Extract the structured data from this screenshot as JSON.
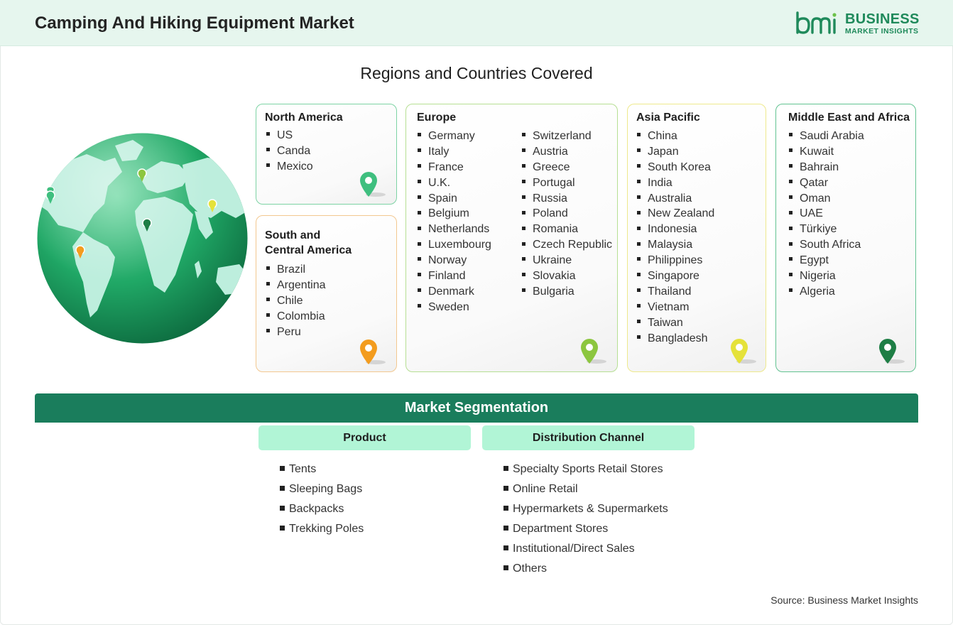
{
  "header": {
    "title": "Camping And Hiking Equipment Market",
    "logo": {
      "word1": "BUSINESS",
      "word2": "MARKET INSIGHTS",
      "mark": "bmi"
    }
  },
  "regions_section": {
    "title": "Regions and Countries Covered",
    "regions": {
      "north_america": {
        "title": "North America",
        "pin_color": "#3fbf7f",
        "items": [
          "US",
          "Canda",
          "Mexico"
        ]
      },
      "south_central_america": {
        "title_line1": "South and",
        "title_line2": "Central America",
        "pin_color": "#f39c1e",
        "items": [
          "Brazil",
          "Argentina",
          "Chile",
          "Colombia",
          "Peru"
        ]
      },
      "europe": {
        "title": "Europe",
        "pin_color": "#8cc63f",
        "items_col1": [
          "Germany",
          "Italy",
          "France",
          "U.K.",
          "Spain",
          "Belgium",
          "Netherlands",
          "Luxembourg",
          "Norway",
          "Finland",
          "Denmark",
          "Sweden"
        ],
        "items_col2": [
          "Switzerland",
          "Austria",
          "Greece",
          "Portugal",
          "Russia",
          "Poland",
          "Romania",
          "Czech Republic",
          "Ukraine",
          "Slovakia",
          "Bulgaria"
        ]
      },
      "asia_pacific": {
        "title": "Asia Pacific",
        "pin_color": "#e5e23a",
        "items": [
          "China",
          "Japan",
          "South Korea",
          "India",
          "Australia",
          "New Zealand",
          "Indonesia",
          "Malaysia",
          "Philippines",
          "Singapore",
          "Thailand",
          "Vietnam",
          "Taiwan",
          "Bangladesh"
        ]
      },
      "middle_east_africa": {
        "title": "Middle East and Africa",
        "pin_color": "#1e7e45",
        "items": [
          "Saudi Arabia",
          "Kuwait",
          "Bahrain",
          "Qatar",
          "Oman",
          "UAE",
          "Türkiye",
          "South Africa",
          "Egypt",
          "Nigeria",
          "Algeria"
        ]
      }
    }
  },
  "segmentation": {
    "title": "Market Segmentation",
    "product": {
      "title": "Product",
      "items": [
        "Tents",
        "Sleeping Bags",
        "Backpacks",
        "Trekking Poles"
      ]
    },
    "distribution": {
      "title": "Distribution Channel",
      "items": [
        "Specialty Sports Retail Stores",
        "Online Retail",
        "Hypermarkets & Supermarkets",
        "Department Stores",
        "Institutional/Direct Sales",
        "Others"
      ]
    }
  },
  "source": "Source: Business Market Insights",
  "colors": {
    "accent": "#1a7d5c",
    "header_bg": "#e6f6ee",
    "segment_head_bg": "#b1f5d6",
    "brand": "#1f8a5b"
  }
}
